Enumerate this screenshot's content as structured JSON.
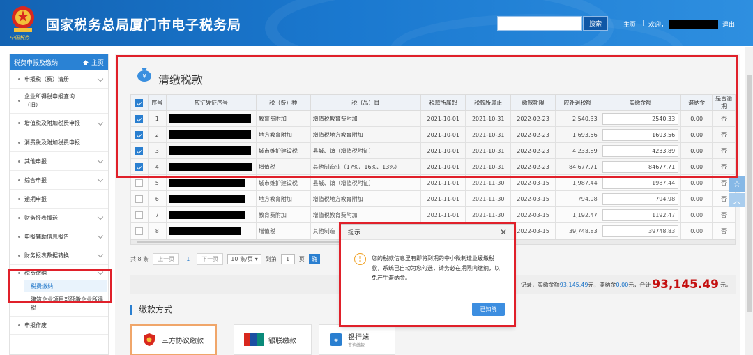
{
  "header": {
    "emblem_text": "中国税务",
    "title": "国家税务总局厦门市电子税务局",
    "search_placeholder": "",
    "search_button": "搜索",
    "home_link": "主页",
    "separator": "|",
    "welcome": "欢迎，",
    "logout": "退出"
  },
  "sidebar": {
    "header": "税费申报及缴纳",
    "home": "主页",
    "items": [
      {
        "label": "申报税（费）清册",
        "has_chevron": true
      },
      {
        "label": "企业所得税申报查询（旧）",
        "has_chevron": false
      },
      {
        "label": "增值税及附加税费申报",
        "has_chevron": true
      },
      {
        "label": "消费税及附加税费申报",
        "has_chevron": false
      },
      {
        "label": "其他申报",
        "has_chevron": true
      },
      {
        "label": "综合申报",
        "has_chevron": true
      },
      {
        "label": "逾期申报",
        "has_chevron": false
      },
      {
        "label": "财务报表报送",
        "has_chevron": true
      },
      {
        "label": "申报辅助信息报告",
        "has_chevron": true
      },
      {
        "label": "财务报表数据转换",
        "has_chevron": true
      },
      {
        "label": "税费缴纳",
        "has_chevron": true
      }
    ],
    "sub_items": [
      {
        "label": "税费缴纳",
        "active": true
      },
      {
        "label": "建筑企业项目部预缴企业所得税",
        "active": false
      }
    ],
    "last_item": "申报作废"
  },
  "main": {
    "page_title": "清缴税款",
    "table": {
      "headers": [
        "序号",
        "应征凭证序号",
        "税（费）种",
        "税（品）目",
        "税款所属起",
        "税款所属止",
        "缴款期限",
        "应补退税额",
        "实缴金额",
        "滞纳金",
        "是否逾期"
      ],
      "rows": [
        {
          "checked": true,
          "no": "1",
          "tax_type": "教育费附加",
          "item": "增值税教育费附加",
          "start": "2021-10-01",
          "end": "2021-10-31",
          "deadline": "2022-02-23",
          "due": "2,540.33",
          "paid": "2540.33",
          "late": "0.00",
          "overdue": "否"
        },
        {
          "checked": true,
          "no": "2",
          "tax_type": "地方教育附加",
          "item": "增值税地方教育附加",
          "start": "2021-10-01",
          "end": "2021-10-31",
          "deadline": "2022-02-23",
          "due": "1,693.56",
          "paid": "1693.56",
          "late": "0.00",
          "overdue": "否"
        },
        {
          "checked": true,
          "no": "3",
          "tax_type": "城市维护建设税",
          "item": "县城、镇（增值税附征）",
          "start": "2021-10-01",
          "end": "2021-10-31",
          "deadline": "2022-02-23",
          "due": "4,233.89",
          "paid": "4233.89",
          "late": "0.00",
          "overdue": "否"
        },
        {
          "checked": true,
          "no": "4",
          "tax_type": "增值税",
          "item": "其他制造业（17%、16%、13%）",
          "start": "2021-10-01",
          "end": "2021-10-31",
          "deadline": "2022-02-23",
          "due": "84,677.71",
          "paid": "84677.71",
          "late": "0.00",
          "overdue": "否"
        },
        {
          "checked": false,
          "no": "5",
          "tax_type": "城市维护建设税",
          "item": "县城、镇（增值税附征）",
          "start": "2021-11-01",
          "end": "2021-11-30",
          "deadline": "2022-03-15",
          "due": "1,987.44",
          "paid": "1987.44",
          "late": "0.00",
          "overdue": "否"
        },
        {
          "checked": false,
          "no": "6",
          "tax_type": "地方教育附加",
          "item": "增值税地方教育附加",
          "start": "2021-11-01",
          "end": "2021-11-30",
          "deadline": "2022-03-15",
          "due": "794.98",
          "paid": "794.98",
          "late": "0.00",
          "overdue": "否"
        },
        {
          "checked": false,
          "no": "7",
          "tax_type": "教育费附加",
          "item": "增值税教育费附加",
          "start": "2021-11-01",
          "end": "2021-11-30",
          "deadline": "2022-03-15",
          "due": "1,192.47",
          "paid": "1192.47",
          "late": "0.00",
          "overdue": "否"
        },
        {
          "checked": false,
          "no": "8",
          "tax_type": "增值税",
          "item": "其他制造",
          "start": "",
          "end": "",
          "deadline": "2022-03-15",
          "due": "39,748.83",
          "paid": "39748.83",
          "late": "0.00",
          "overdue": "否"
        }
      ]
    },
    "pager": {
      "total": "共 8 条",
      "prev": "上一页",
      "current": "1",
      "next": "下一页",
      "per_page": "10 条/页",
      "goto": "到第",
      "goto_value": "1",
      "page_unit": "页",
      "confirm": "确"
    },
    "summary": {
      "prefix": "记录，实缴金额",
      "paid_total": "93,145.49",
      "mid1": " 元，滞纳金 ",
      "late_total": "0.00",
      "mid2": "元，合计",
      "grand_total": "93,145.49",
      "suffix": "元。"
    },
    "payment": {
      "title": "缴款方式",
      "options": [
        {
          "label": "三方协议缴款",
          "sub": "",
          "icon": "tax-shield-icon"
        },
        {
          "label": "银联缴款",
          "sub": "",
          "icon": "unionpay-icon"
        },
        {
          "label": "银行端",
          "sub": "查询缴款",
          "icon": "bank-icon"
        }
      ]
    }
  },
  "dialog": {
    "title": "提示",
    "message": "您的税款信息里有即将到期的中小微制造业缓缴税款，系统已自动为您勾选，请务必在期限内缴纳，以免产生滞纳金。",
    "ok_button": "已知晓"
  },
  "colors": {
    "header_blue": "#1a78cf",
    "highlight_red": "#e0202a",
    "accent_blue": "#2a7fd0",
    "total_red": "#c40f0f"
  }
}
